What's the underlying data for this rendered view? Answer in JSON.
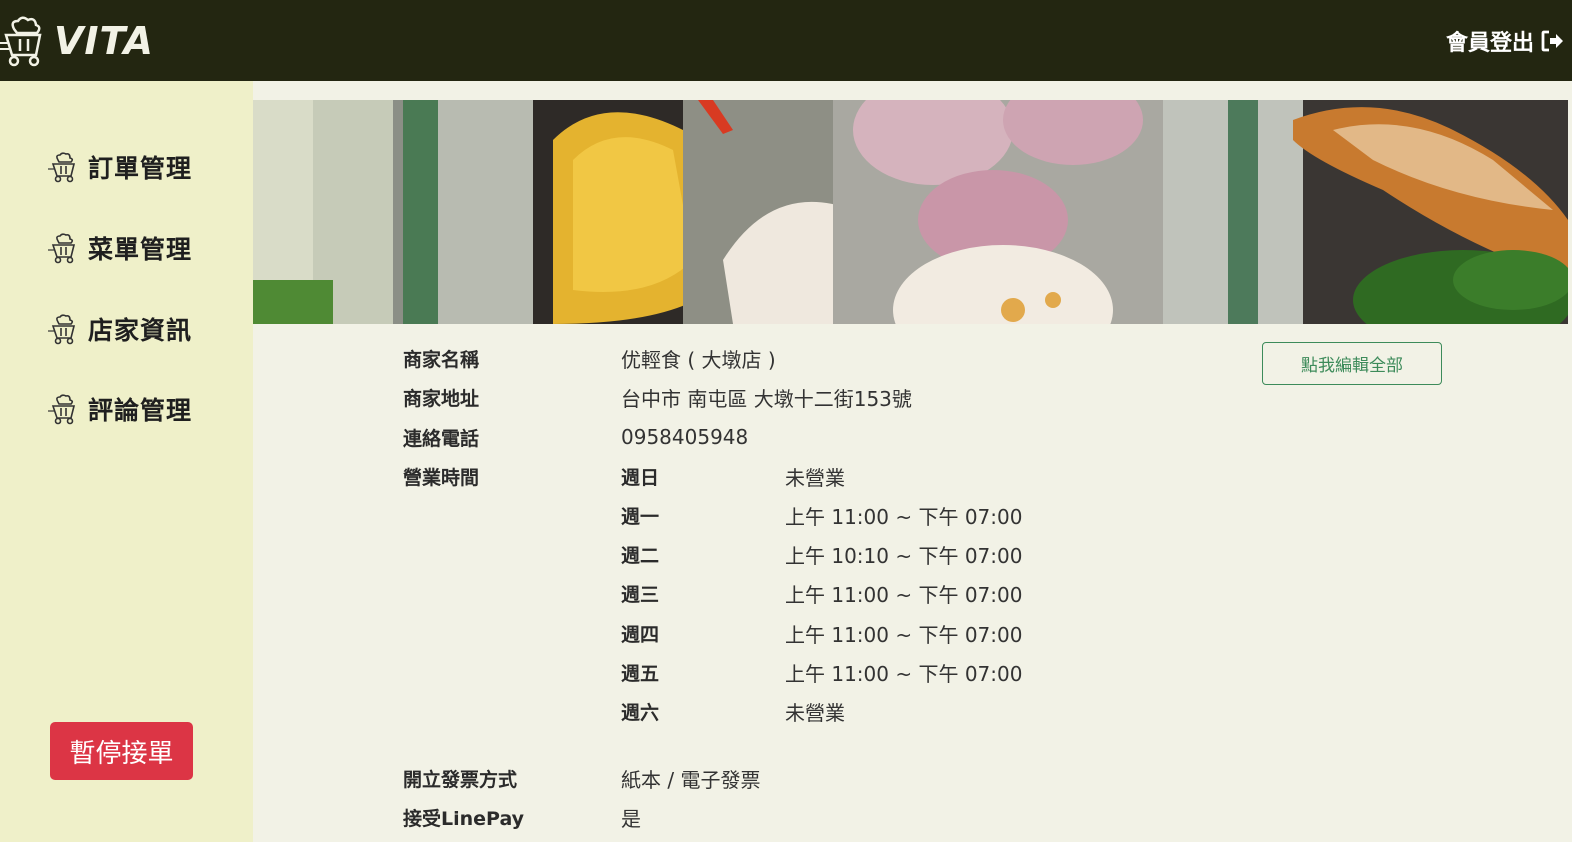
{
  "header": {
    "logo_text": "VITA",
    "logout_label": "會員登出"
  },
  "sidebar": {
    "items": [
      {
        "label": "訂單管理",
        "icon": "chef-cart-icon"
      },
      {
        "label": "菜單管理",
        "icon": "chef-cart-icon"
      },
      {
        "label": "店家資訊",
        "icon": "chef-cart-icon"
      },
      {
        "label": "評論管理",
        "icon": "chef-cart-icon"
      }
    ],
    "pause_label": "暫停接單"
  },
  "store": {
    "edit_label": "點我編輯全部",
    "name_label": "商家名稱",
    "name_value": "优輕食 ( 大墩店 )",
    "address_label": "商家地址",
    "address_value": "台中市 南屯區 大墩十二街153號",
    "phone_label": "連絡電話",
    "phone_value": "0958405948",
    "hours_label": "營業時間",
    "hours": [
      {
        "day": "週日",
        "time": "未營業"
      },
      {
        "day": "週一",
        "time": "上午 11:00 ~ 下午 07:00"
      },
      {
        "day": "週二",
        "time": "上午 10:10 ~ 下午 07:00"
      },
      {
        "day": "週三",
        "time": "上午 11:00 ~ 下午 07:00"
      },
      {
        "day": "週四",
        "time": "上午 11:00 ~ 下午 07:00"
      },
      {
        "day": "週五",
        "time": "上午 11:00 ~ 下午 07:00"
      },
      {
        "day": "週六",
        "time": "未營業"
      }
    ],
    "invoice_label": "開立發票方式",
    "invoice_value": "紙本 / 電子發票",
    "linepay_label": "接受LinePay",
    "linepay_value": "是"
  },
  "colors": {
    "topbar": "#232611",
    "sidebar": "#eff0c9",
    "background": "#f2f2e6",
    "pause": "#dc3545",
    "accent": "#3d8b5a"
  }
}
